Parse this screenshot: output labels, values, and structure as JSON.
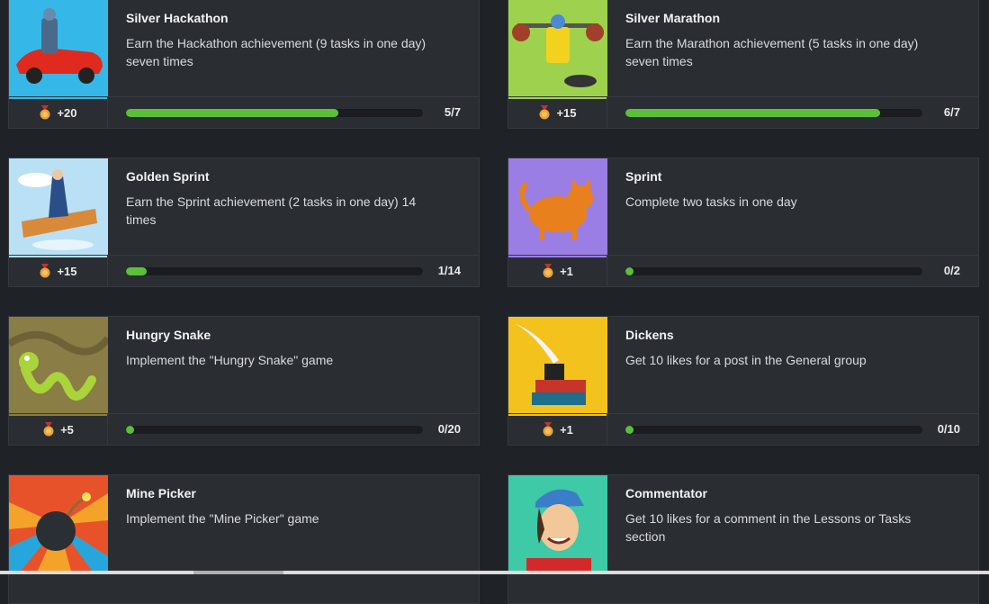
{
  "achievements": [
    {
      "title": "Silver Hackathon",
      "description": "Earn the Hackathon achievement (9 tasks in one day) seven times",
      "reward": "+20",
      "progress_text": "5/7",
      "progress": 0.714,
      "thumb_color": "#35b8e8",
      "icon": "car-robot-image"
    },
    {
      "title": "Silver Marathon",
      "description": "Earn the Marathon achievement (5 tasks in one day) seven times",
      "reward": "+15",
      "progress_text": "6/7",
      "progress": 0.857,
      "thumb_color": "#9ed24e",
      "icon": "weightlifter-robot-image"
    },
    {
      "title": "Golden Sprint",
      "description": "Earn the Sprint achievement (2 tasks in one day) 14 times",
      "reward": "+15",
      "progress_text": "1/14",
      "progress": 0.071,
      "thumb_color": "#b9e0f5",
      "icon": "flying-carpet-image"
    },
    {
      "title": "Sprint",
      "description": "Complete two tasks in one day",
      "reward": "+1",
      "progress_text": "0/2",
      "progress": 0,
      "thumb_color": "#9b7ee4",
      "icon": "orange-cat-image"
    },
    {
      "title": "Hungry Snake",
      "description": "Implement the \"Hungry Snake\" game",
      "reward": "+5",
      "progress_text": "0/20",
      "progress": 0,
      "thumb_color": "#8a7d45",
      "icon": "snake-image"
    },
    {
      "title": "Dickens",
      "description": "Get 10 likes for a post in the General group",
      "reward": "+1",
      "progress_text": "0/10",
      "progress": 0,
      "thumb_color": "#f4c21d",
      "icon": "books-quill-image"
    },
    {
      "title": "Mine Picker",
      "description": "Implement the \"Mine Picker\" game",
      "reward": "",
      "progress_text": "",
      "progress": 0,
      "thumb_color": "#e8522a",
      "icon": "bomb-image"
    },
    {
      "title": "Commentator",
      "description": "Get 10 likes for a comment in the Lessons or Tasks section",
      "reward": "",
      "progress_text": "",
      "progress": 0,
      "thumb_color": "#3ec9a7",
      "icon": "cartoon-man-image"
    }
  ],
  "colors": {
    "accent": "#5cbf3a",
    "medal": "#e9a23b"
  }
}
